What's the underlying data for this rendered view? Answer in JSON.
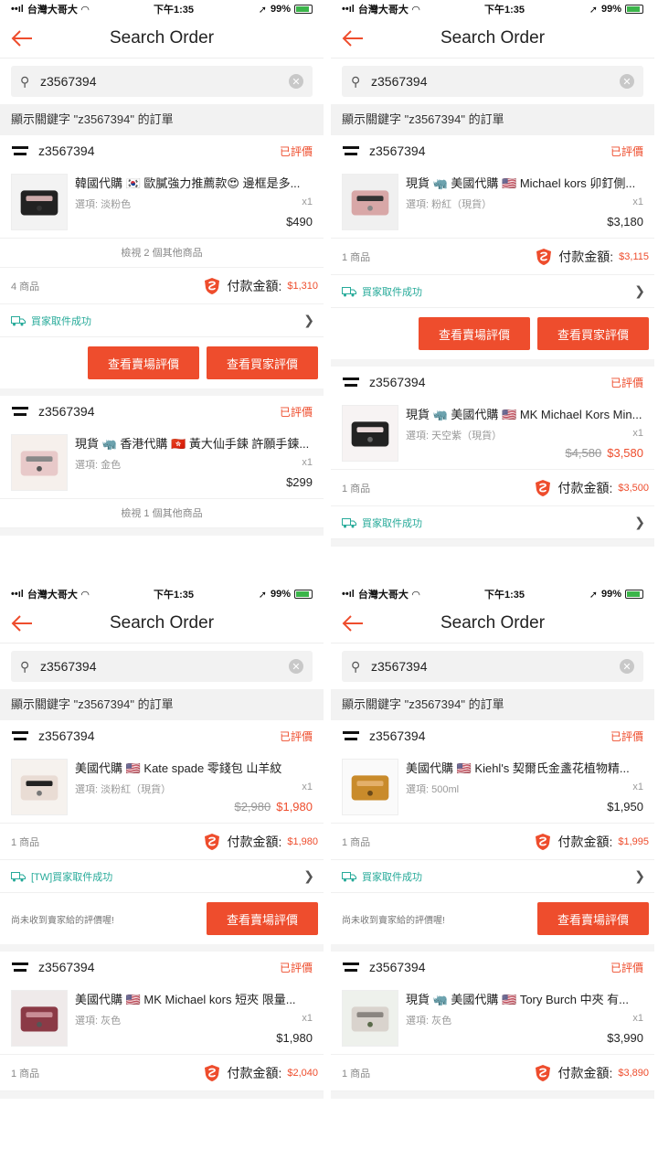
{
  "status_bar": {
    "carrier": "台灣大哥大",
    "time": "下午1:35",
    "battery": "99%"
  },
  "nav": {
    "title": "Search Order"
  },
  "search": {
    "value": "z3567394"
  },
  "keyword_banner": "顯示關鍵字 \"z3567394\" 的訂單",
  "labels": {
    "total": "付款金額:",
    "btn_shop_review": "查看賣場評價",
    "btn_buyer_review": "查看買家評價",
    "no_review_note": "尚未收到賣家給的評價喔!"
  },
  "panels": [
    {
      "orders": [
        {
          "shop": "z3567394",
          "status": "已評價",
          "product": {
            "name": "韓國代購 🇰🇷 歐膩強力推薦款😍 邊框是多...",
            "option": "選項: 淡粉色",
            "qty": "x1",
            "orig_price": "",
            "price": "$490"
          },
          "more": "檢視 2 個其他商品",
          "count": "4 商品",
          "total": "$1,310",
          "shipping": "買家取件成功",
          "note": "",
          "buttons": [
            "查看賣場評價",
            "查看買家評價"
          ]
        },
        {
          "shop": "z3567394",
          "status": "已評價",
          "product": {
            "name": "現貨 🦏 香港代購 🇭🇰 黃大仙手鍊 許願手鍊...",
            "option": "選項: 金色",
            "qty": "x1",
            "orig_price": "",
            "price": "$299"
          },
          "more": "檢視 1 個其他商品"
        }
      ]
    },
    {
      "orders": [
        {
          "shop": "z3567394",
          "status": "已評價",
          "product": {
            "name": "現貨 🦏 美國代購 🇺🇸 Michael kors 卯釘側...",
            "option": "選項: 粉紅（現貨）",
            "qty": "x1",
            "orig_price": "",
            "price": "$3,180"
          },
          "count": "1 商品",
          "total": "$3,115",
          "shipping": "買家取件成功",
          "note": "",
          "buttons": [
            "查看賣場評價",
            "查看買家評價"
          ]
        },
        {
          "shop": "z3567394",
          "status": "已評價",
          "product": {
            "name": "現貨 🦏 美國代購 🇺🇸 MK Michael Kors Min...",
            "option": "選項: 天空紫（現貨）",
            "qty": "x1",
            "orig_price": "$4,580",
            "price": "$3,580"
          },
          "count": "1 商品",
          "total": "$3,500",
          "shipping": "買家取件成功"
        }
      ]
    },
    {
      "orders": [
        {
          "shop": "z3567394",
          "status": "已評價",
          "product": {
            "name": "美國代購 🇺🇸 Kate spade 零錢包 山羊紋",
            "option": "選項: 淡粉紅（現貨）",
            "qty": "x1",
            "orig_price": "$2,980",
            "price": "$1,980"
          },
          "count": "1 商品",
          "total": "$1,980",
          "shipping": "[TW]買家取件成功",
          "note": "尚未收到賣家給的評價喔!",
          "buttons": [
            "查看賣場評價"
          ]
        },
        {
          "shop": "z3567394",
          "status": "已評價",
          "product": {
            "name": "美國代購 🇺🇸 MK Michael kors 短夾 限量...",
            "option": "選項: 灰色",
            "qty": "x1",
            "orig_price": "",
            "price": "$1,980"
          },
          "count": "1 商品",
          "total": "$2,040"
        }
      ]
    },
    {
      "orders": [
        {
          "shop": "z3567394",
          "status": "已評價",
          "product": {
            "name": "美國代購 🇺🇸 Kiehl's 契爾氏金盞花植物精...",
            "option": "選項: 500ml",
            "qty": "x1",
            "orig_price": "",
            "price": "$1,950"
          },
          "count": "1 商品",
          "total": "$1,995",
          "shipping": "買家取件成功",
          "note": "尚未收到賣家給的評價喔!",
          "buttons": [
            "查看賣場評價"
          ]
        },
        {
          "shop": "z3567394",
          "status": "已評價",
          "product": {
            "name": "現貨 🦏 美國代購 🇺🇸 Tory Burch 中夾 有...",
            "option": "選項: 灰色",
            "qty": "x1",
            "orig_price": "",
            "price": "$3,990"
          },
          "count": "1 商品",
          "total": "$3,890"
        }
      ]
    }
  ],
  "colors": {
    "accent": "#ee4d2d",
    "shipping_green": "#26aa99"
  }
}
